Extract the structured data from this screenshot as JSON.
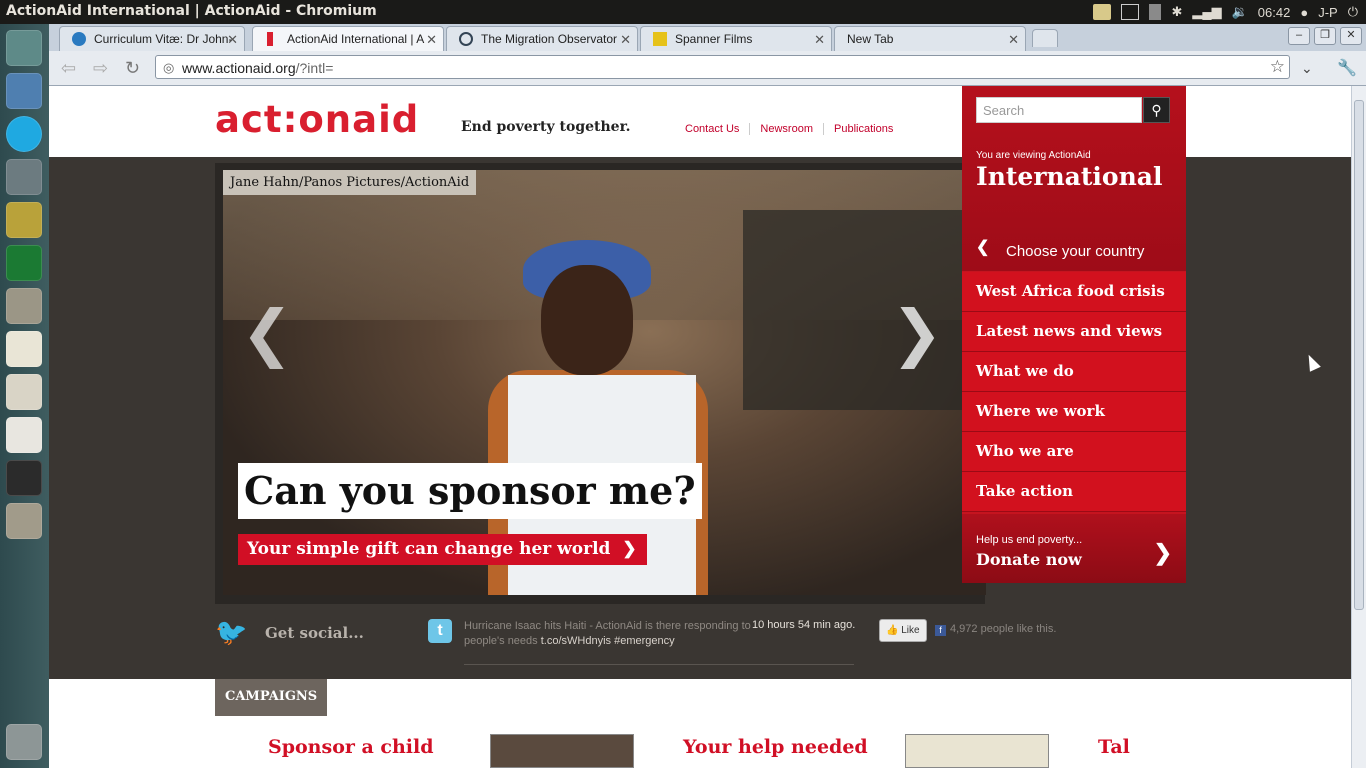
{
  "system": {
    "window_title": "ActionAid International | ActionAid - Chromium",
    "time": "06:42",
    "user": "J-P"
  },
  "browser": {
    "tabs": [
      {
        "label": "Curriculum Vitæ: Dr John-",
        "icon": "drupal-icon"
      },
      {
        "label": "ActionAid International | A",
        "icon": "actionaid-icon"
      },
      {
        "label": "The Migration Observator",
        "icon": "globe-icon"
      },
      {
        "label": "Spanner Films",
        "icon": "spanner-icon"
      },
      {
        "label": "New Tab",
        "icon": ""
      }
    ],
    "url_host": "www.actionaid.org",
    "url_path": "/?intl="
  },
  "site": {
    "logo": "act:onaid",
    "tagline": "End poverty together.",
    "top_links": [
      "Contact Us",
      "Newsroom",
      "Publications"
    ]
  },
  "hero": {
    "credit": "Jane Hahn/Panos Pictures/ActionAid",
    "headline": "Can you sponsor me?",
    "subhead": "Your simple gift can change her world",
    "subhead_chevron": "❯"
  },
  "panel": {
    "search_placeholder": "Search",
    "viewing_label": "You are viewing ActionAid",
    "region": "International",
    "choose_label": "Choose your country",
    "menu": [
      "West Africa food crisis",
      "Latest news and views",
      "What we do",
      "Where we work",
      "Who we are",
      "Take action"
    ],
    "donate_small": "Help us end poverty...",
    "donate_big": "Donate now"
  },
  "social": {
    "label": "Get social...",
    "tweet_text": "Hurricane Isaac hits Haiti - ActionAid is there responding to people's needs",
    "tweet_link": "t.co/sWHdnyis",
    "tweet_tag": "#emergency",
    "tweet_time": "10 hours 54 min ago.",
    "like_label": "Like",
    "fb_count": "4,972 people like this."
  },
  "campaigns": {
    "tab_label": "CAMPAIGNS",
    "items": [
      "Sponsor a child",
      "Your help needed",
      "Tal"
    ]
  },
  "colors": {
    "brand_red": "#d91f2f",
    "menu_red": "#d2111e",
    "link_red": "#c2002b"
  }
}
